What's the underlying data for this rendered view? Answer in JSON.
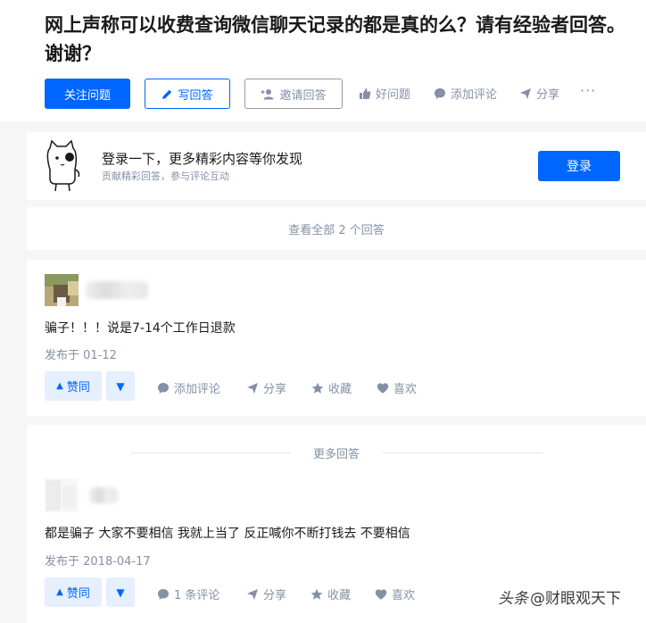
{
  "question": {
    "title": "网上声称可以收费查询微信聊天记录的都是真的么？请有经验者回答。谢谢？",
    "follow_label": "关注问题",
    "write_label": "写回答",
    "invite_label": "邀请回答",
    "good_question_label": "好问题",
    "add_comment_label": "添加评论",
    "share_label": "分享",
    "more_label": "···"
  },
  "login_prompt": {
    "title": "登录一下，更多精彩内容等你发现",
    "subtitle": "贡献精彩回答，参与评论互动",
    "button_label": "登录"
  },
  "view_all_label": "查看全部 2 个回答",
  "answers": [
    {
      "text": "骗子！！！说是7-14个工作日退款",
      "date": "发布于 01-12",
      "upvote_label": "赞同",
      "comment_label": "添加评论",
      "share_label": "分享",
      "collect_label": "收藏",
      "like_label": "喜欢"
    },
    {
      "text": "都是骗子 大家不要相信 我就上当了 反正喊你不断打钱去 不要相信",
      "date": "发布于 2018-04-17",
      "upvote_label": "赞同",
      "comment_label": "1 条评论",
      "share_label": "分享",
      "collect_label": "收藏",
      "like_label": "喜欢"
    }
  ],
  "more_answers_label": "更多回答",
  "watermark": {
    "prefix": "头条",
    "account": "@财眼观天下"
  },
  "colors": {
    "brand_blue": "#0066ff",
    "muted_text": "#8590a6",
    "vote_bg": "#e5effe"
  }
}
